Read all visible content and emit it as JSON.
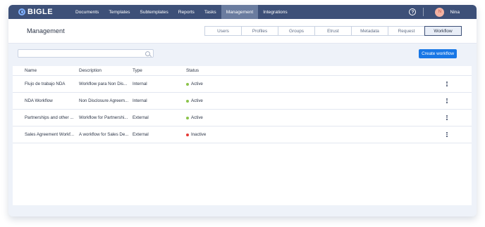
{
  "app": {
    "logo": "BIGLE"
  },
  "nav": {
    "items": [
      {
        "label": "Documents",
        "active": false
      },
      {
        "label": "Templates",
        "active": false
      },
      {
        "label": "Subtemplates",
        "active": false
      },
      {
        "label": "Reports",
        "active": false
      },
      {
        "label": "Tasks",
        "active": false
      },
      {
        "label": "Management",
        "active": true
      },
      {
        "label": "Integrations",
        "active": false
      }
    ],
    "help_label": "?",
    "user": {
      "initial": "N",
      "name": "Nina"
    }
  },
  "header": {
    "title": "Management",
    "tabs": [
      {
        "label": "Users",
        "active": false
      },
      {
        "label": "Profiles",
        "active": false
      },
      {
        "label": "Groups",
        "active": false
      },
      {
        "label": "Etrust",
        "active": false
      },
      {
        "label": "Metadata",
        "active": false
      },
      {
        "label": "Request",
        "active": false
      },
      {
        "label": "Workflow",
        "active": true
      }
    ]
  },
  "toolbar": {
    "search_value": "",
    "create_label": "Create workflow"
  },
  "table": {
    "headers": {
      "name": "Name",
      "description": "Description",
      "type": "Type",
      "status": "Status"
    },
    "rows": [
      {
        "name": "Flujo de trabajo NDA",
        "description": "Workflow para Non Dis...",
        "type": "Internal",
        "status": "Active",
        "status_color": "#8bc34a"
      },
      {
        "name": "NDA Workflow",
        "description": "Non Disclosure Agreem...",
        "type": "Internal",
        "status": "Active",
        "status_color": "#8bc34a"
      },
      {
        "name": "Partnerships and other ...",
        "description": "Workflow for Partnershi...",
        "type": "External",
        "status": "Active",
        "status_color": "#8bc34a"
      },
      {
        "name": "Sales Agreement Workf...",
        "description": "A workflow for Sales De...",
        "type": "External",
        "status": "Inactive",
        "status_color": "#e53935"
      }
    ]
  },
  "colors": {
    "nav_bg": "#3d5078",
    "accent": "#1877e6"
  }
}
